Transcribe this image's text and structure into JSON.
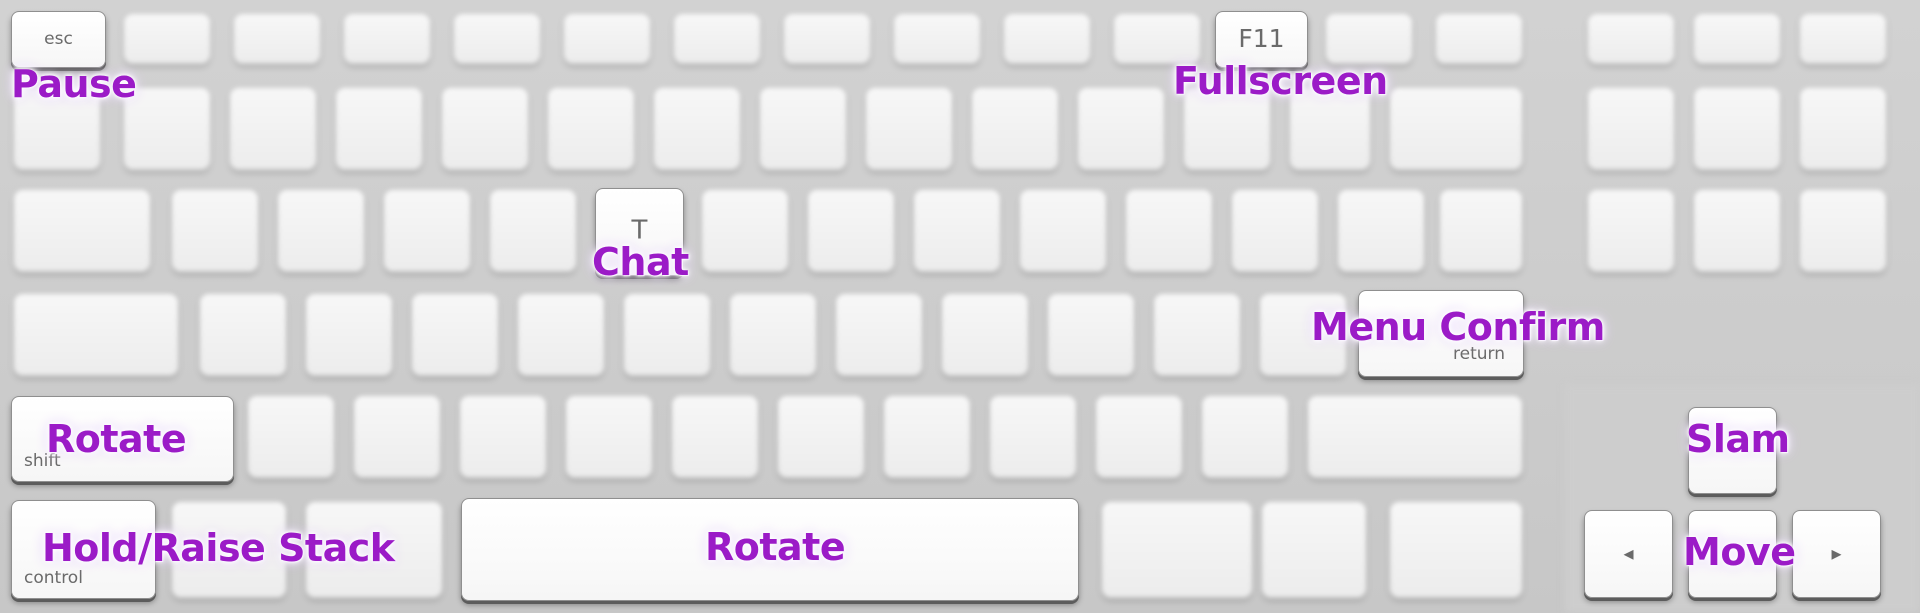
{
  "highlighted_keys": {
    "esc": "esc",
    "f11": "F11",
    "t": "T",
    "return": "return",
    "shift": "shift",
    "control": "control",
    "left": "◂",
    "right": "▸"
  },
  "actions": {
    "pause": "Pause",
    "fullscreen": "Fullscreen",
    "chat": "Chat",
    "menu_confirm": "Menu Confirm",
    "rotate_shift": "Rotate",
    "hold_raise_stack": "Hold/Raise Stack",
    "rotate_space": "Rotate",
    "slam": "Slam",
    "move": "Move"
  }
}
